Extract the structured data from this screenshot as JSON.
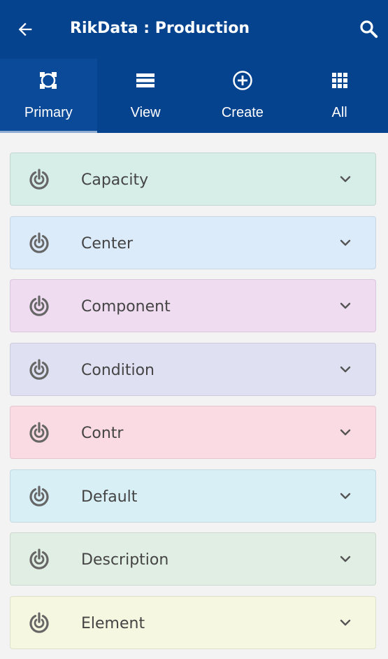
{
  "header": {
    "title": "RikData : Production",
    "back_icon": "arrow-left-icon",
    "search_icon": "search-icon"
  },
  "tabs": [
    {
      "label": "Primary",
      "icon": "primary-icon",
      "active": true
    },
    {
      "label": "View",
      "icon": "list-icon",
      "active": false
    },
    {
      "label": "Create",
      "icon": "add-circle-icon",
      "active": false
    },
    {
      "label": "All",
      "icon": "grid-icon",
      "active": false
    }
  ],
  "items": [
    {
      "label": "Capacity",
      "color": "#d7ede7"
    },
    {
      "label": "Center",
      "color": "#dcebfa"
    },
    {
      "label": "Component",
      "color": "#efdcf1"
    },
    {
      "label": "Condition",
      "color": "#dfe1f2"
    },
    {
      "label": "Contr",
      "color": "#fadbe3"
    },
    {
      "label": "Default",
      "color": "#d8eff6"
    },
    {
      "label": "Description",
      "color": "#e1eee3"
    },
    {
      "label": "Element",
      "color": "#f5f7e1"
    }
  ],
  "colors": {
    "appbar": "#06438f",
    "background": "#f3f3f3"
  }
}
